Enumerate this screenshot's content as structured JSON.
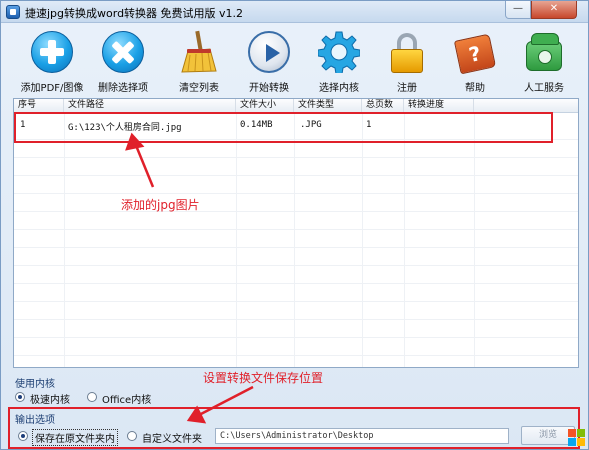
{
  "window": {
    "title": "捷速jpg转换成word转换器 免费试用版 v1.2",
    "minimize": "—",
    "close": "✕"
  },
  "toolbar": [
    {
      "label": "添加PDF/图像",
      "icon": "add-icon"
    },
    {
      "label": "删除选择项",
      "icon": "delete-icon"
    },
    {
      "label": "清空列表",
      "icon": "broom-icon"
    },
    {
      "label": "开始转换",
      "icon": "play-icon"
    },
    {
      "label": "选择内核",
      "icon": "gear-icon"
    },
    {
      "label": "注册",
      "icon": "lock-icon"
    },
    {
      "label": "帮助",
      "icon": "help-book-icon"
    },
    {
      "label": "人工服务",
      "icon": "phone-icon"
    }
  ],
  "table": {
    "columns": [
      "序号",
      "文件路径",
      "文件大小",
      "文件类型",
      "总页数",
      "转换进度"
    ],
    "rows": [
      {
        "index": "1",
        "path": "G:\\123\\个人租房合同.jpg",
        "size": "0.14MB",
        "type": ".JPG",
        "pages": "1",
        "progress": ""
      }
    ]
  },
  "annotations": {
    "added_jpg": "添加的jpg图片",
    "set_location": "设置转换文件保存位置"
  },
  "engine": {
    "label": "使用内核",
    "options": [
      {
        "label": "极速内核",
        "selected": true
      },
      {
        "label": "Office内核",
        "selected": false
      }
    ]
  },
  "output": {
    "label": "输出选项",
    "options": [
      {
        "label": "保存在原文件夹内",
        "selected": true
      },
      {
        "label": "自定义文件夹",
        "selected": false
      }
    ],
    "path": "C:\\Users\\Administrator\\Desktop",
    "browse_label": "浏览"
  },
  "colors": {
    "annotation": "#e0202a",
    "accent": "#1aa0e6"
  }
}
